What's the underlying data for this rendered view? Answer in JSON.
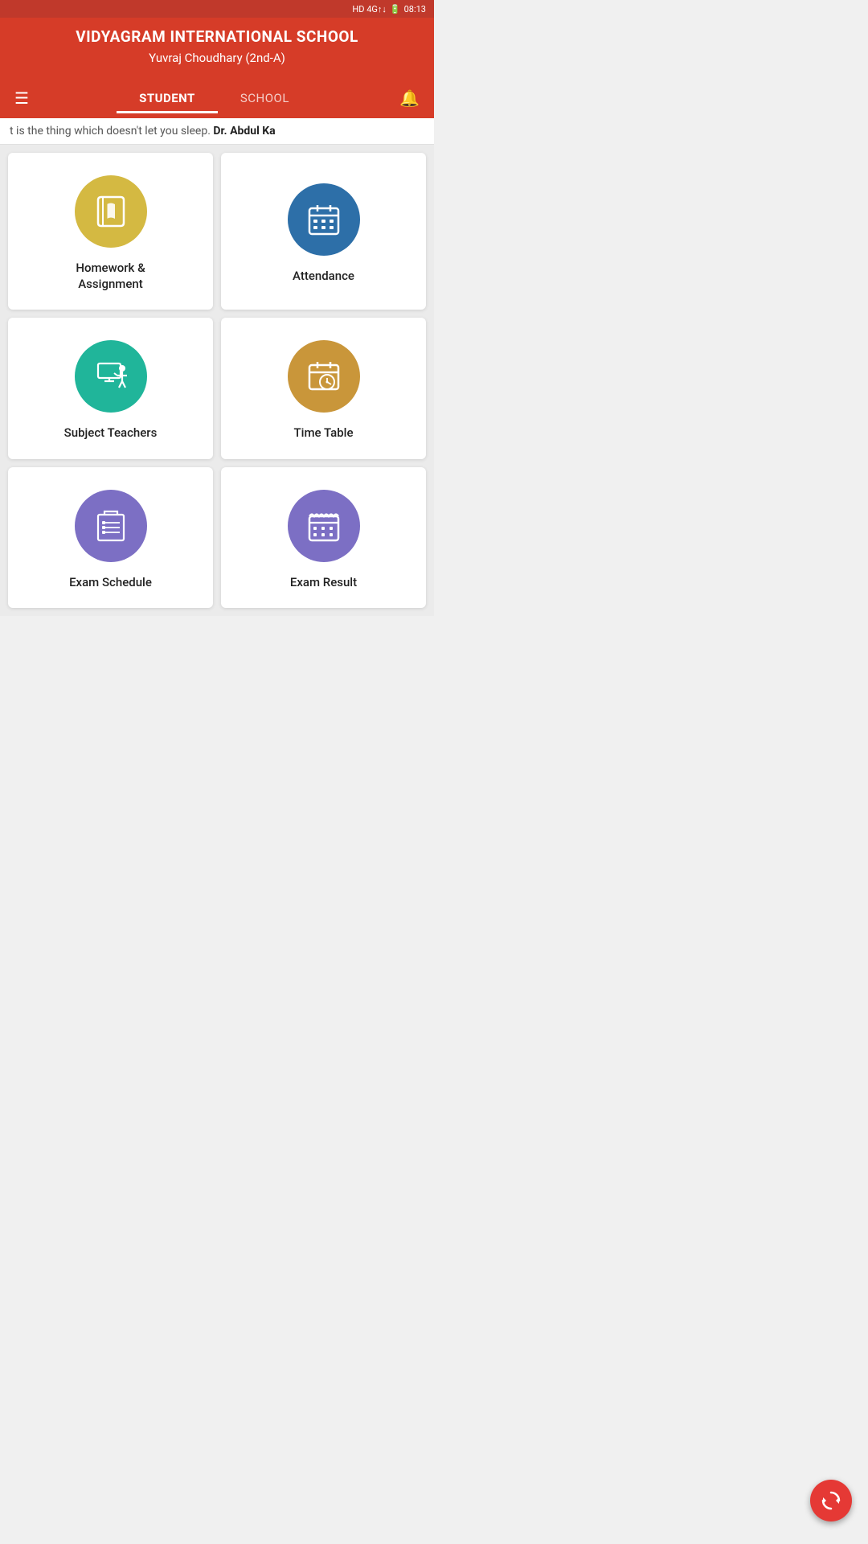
{
  "statusBar": {
    "network": "HD 4G",
    "time": "08:13",
    "battery": "full"
  },
  "header": {
    "title": "VIDYAGRAM INTERNATIONAL SCHOOL",
    "subtitle": "Yuvraj  Choudhary  (2nd-A)"
  },
  "tabs": {
    "student": "STUDENT",
    "school": "SCHOOL",
    "active": "student"
  },
  "marquee": {
    "text": "t is the thing which doesn't let you sleep.",
    "highlight": "Dr. Abdul Ka"
  },
  "cards": [
    {
      "id": "homework",
      "label": "Homework &\nAssignment",
      "iconColor": "ic-yellow",
      "icon": "book"
    },
    {
      "id": "attendance",
      "label": "Attendance",
      "iconColor": "ic-blue",
      "icon": "calendar"
    },
    {
      "id": "subject-teachers",
      "label": "Subject Teachers",
      "iconColor": "ic-teal",
      "icon": "teacher"
    },
    {
      "id": "timetable",
      "label": "Time Table",
      "iconColor": "ic-gold",
      "icon": "timetable"
    },
    {
      "id": "exam-schedule",
      "label": "Exam Schedule",
      "iconColor": "ic-purple",
      "icon": "exam-schedule"
    },
    {
      "id": "exam-result",
      "label": "Exam Result",
      "iconColor": "ic-purple2",
      "icon": "exam-result"
    }
  ]
}
